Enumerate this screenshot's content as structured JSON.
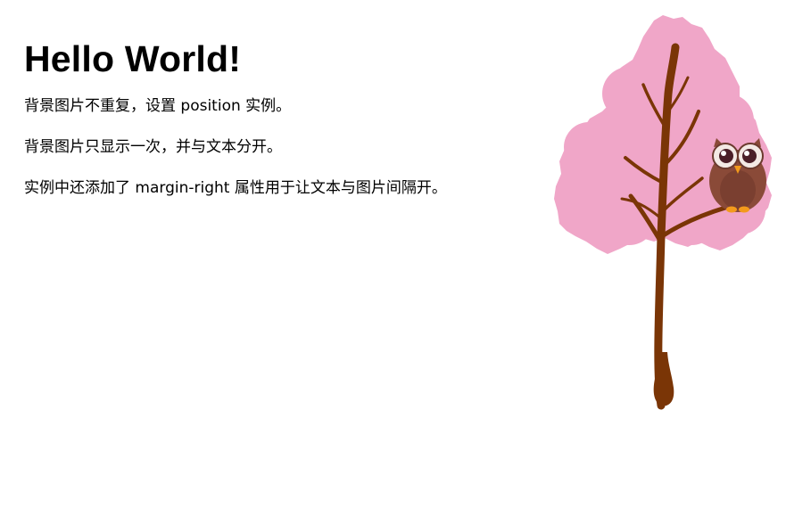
{
  "heading": "Hello World!",
  "paragraphs": [
    "背景图片不重复，设置 position 实例。",
    "背景图片只显示一次，并与文本分开。",
    "实例中还添加了 margin-right 属性用于让文本与图片间隔开。"
  ],
  "image": {
    "icon": "tree-with-owl-icon"
  },
  "colors": {
    "background": "#ffffff",
    "text": "#000000",
    "blossom": "#f0a6c8",
    "trunk": "#7a3506",
    "owl_body": "#8a4a38",
    "owl_feet": "#f39a1c"
  }
}
